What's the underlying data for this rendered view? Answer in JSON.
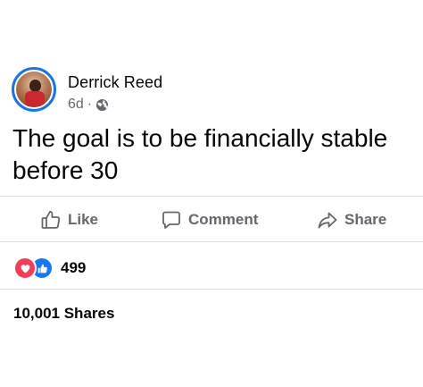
{
  "post": {
    "author": "Derrick Reed",
    "time": "6d",
    "separator": "·",
    "privacy_icon": "globe-icon",
    "text": "The goal is to be financially stable before 30"
  },
  "actions": {
    "like_label": "Like",
    "comment_label": "Comment",
    "share_label": "Share"
  },
  "reactions": {
    "icons": [
      "love-icon",
      "like-icon"
    ],
    "count": "499"
  },
  "shares": {
    "label": "10,001 Shares"
  },
  "colors": {
    "avatar_ring": "#1b74e4",
    "secondary_text": "#65676b",
    "love": "#f33e58",
    "like": "#1877f2",
    "divider": "#dadde1"
  }
}
